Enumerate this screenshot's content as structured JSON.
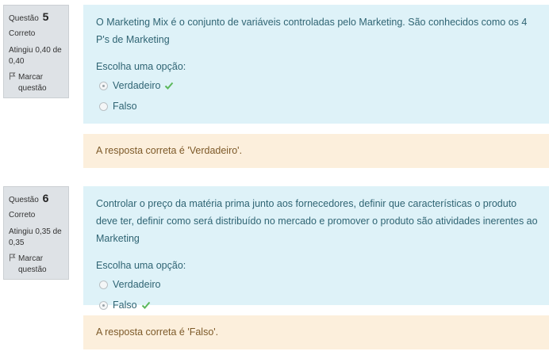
{
  "questions": [
    {
      "label": "Questão",
      "number": "5",
      "state": "Correto",
      "grade": "Atingiu 0,40 de 0,40",
      "flag_label": "Marcar questão",
      "text": "O Marketing Mix é o conjunto de variáveis controladas pelo Marketing. São conhecidos como os 4 P's de Marketing",
      "prompt": "Escolha uma opção:",
      "options": [
        {
          "label": "Verdadeiro",
          "selected": true,
          "correct": true
        },
        {
          "label": "Falso",
          "selected": false,
          "correct": false
        }
      ],
      "feedback": "A resposta correta é 'Verdadeiro'."
    },
    {
      "label": "Questão",
      "number": "6",
      "state": "Correto",
      "grade": "Atingiu 0,35 de 0,35",
      "flag_label": "Marcar questão",
      "text": "Controlar o preço da matéria prima junto aos fornecedores, definir que características o produto deve ter, definir como será distribuído no mercado e promover o produto são atividades inerentes ao Marketing",
      "prompt": "Escolha uma opção:",
      "options": [
        {
          "label": "Verdadeiro",
          "selected": false,
          "correct": false
        },
        {
          "label": "Falso",
          "selected": true,
          "correct": true
        }
      ],
      "feedback": "A resposta correta é 'Falso'."
    }
  ],
  "colors": {
    "info_bg": "#dee2e6",
    "formulation_bg": "#def2f8",
    "formulation_text": "#2f6473",
    "feedback_bg": "#fcefdc",
    "feedback_text": "#7d5a29",
    "correct_check": "#5cb85c"
  },
  "icons": {
    "flag": "flag-icon",
    "correct": "check-icon"
  }
}
